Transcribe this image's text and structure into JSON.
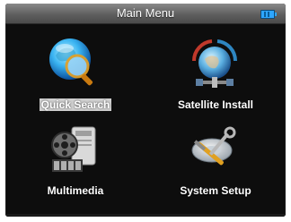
{
  "window": {
    "title": "Main Menu"
  },
  "status": {
    "battery_icon": "battery-icon",
    "battery_color": "#2ea6ff"
  },
  "menu": {
    "selected_index": 0,
    "items": [
      {
        "label": "Quick Search",
        "icon": "globe-magnifier-icon",
        "selected": true
      },
      {
        "label": "Satellite Install",
        "icon": "satellite-globe-icon",
        "selected": false
      },
      {
        "label": "Multimedia",
        "icon": "film-reel-device-icon",
        "selected": false
      },
      {
        "label": "System Setup",
        "icon": "tools-dish-icon",
        "selected": false
      }
    ]
  },
  "colors": {
    "background": "#0d0d0d",
    "title_bar": "#6a6a6a",
    "text": "#ffffff",
    "selection": "#cfcfcf"
  }
}
